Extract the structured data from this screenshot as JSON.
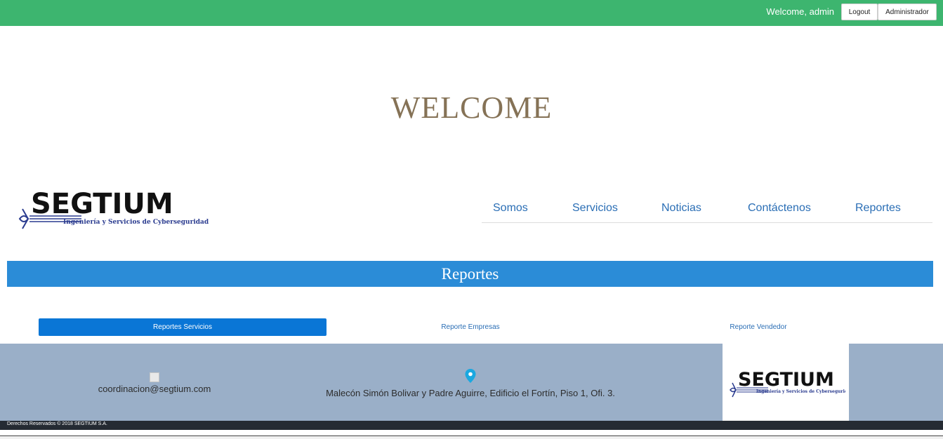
{
  "topbar": {
    "welcome": "Welcome, admin",
    "logout_label": "Logout",
    "admin_label": "Administrador",
    "bg_color": "#3db56f"
  },
  "hero": {
    "title": "WELCOME"
  },
  "logo": {
    "brand": "SEGTIUM",
    "tagline": "Ingeniería y Servicios de Cyberseguridad"
  },
  "nav": {
    "items": [
      {
        "label": "Somos"
      },
      {
        "label": "Servicios"
      },
      {
        "label": "Noticias"
      },
      {
        "label": "Contáctenos"
      },
      {
        "label": "Reportes"
      }
    ]
  },
  "section": {
    "title": "Reportes",
    "color": "#2b8cd7"
  },
  "tabs": [
    {
      "label": "Reportes Servicios",
      "active": true
    },
    {
      "label": "Reporte Empresas",
      "active": false
    },
    {
      "label": "Reporte Vendedor",
      "active": false
    }
  ],
  "footer": {
    "email": "coordinacion@segtium.com",
    "address": "Malecón Simón Bolivar y Padre Aguirre, Edificio el Fortín, Piso 1, Ofi. 3.",
    "copyright": "Derechos Reservados © 2018 SEGTIUM S.A.",
    "bg_color": "#9aafc8",
    "pin_icon": "location-pin-icon"
  }
}
